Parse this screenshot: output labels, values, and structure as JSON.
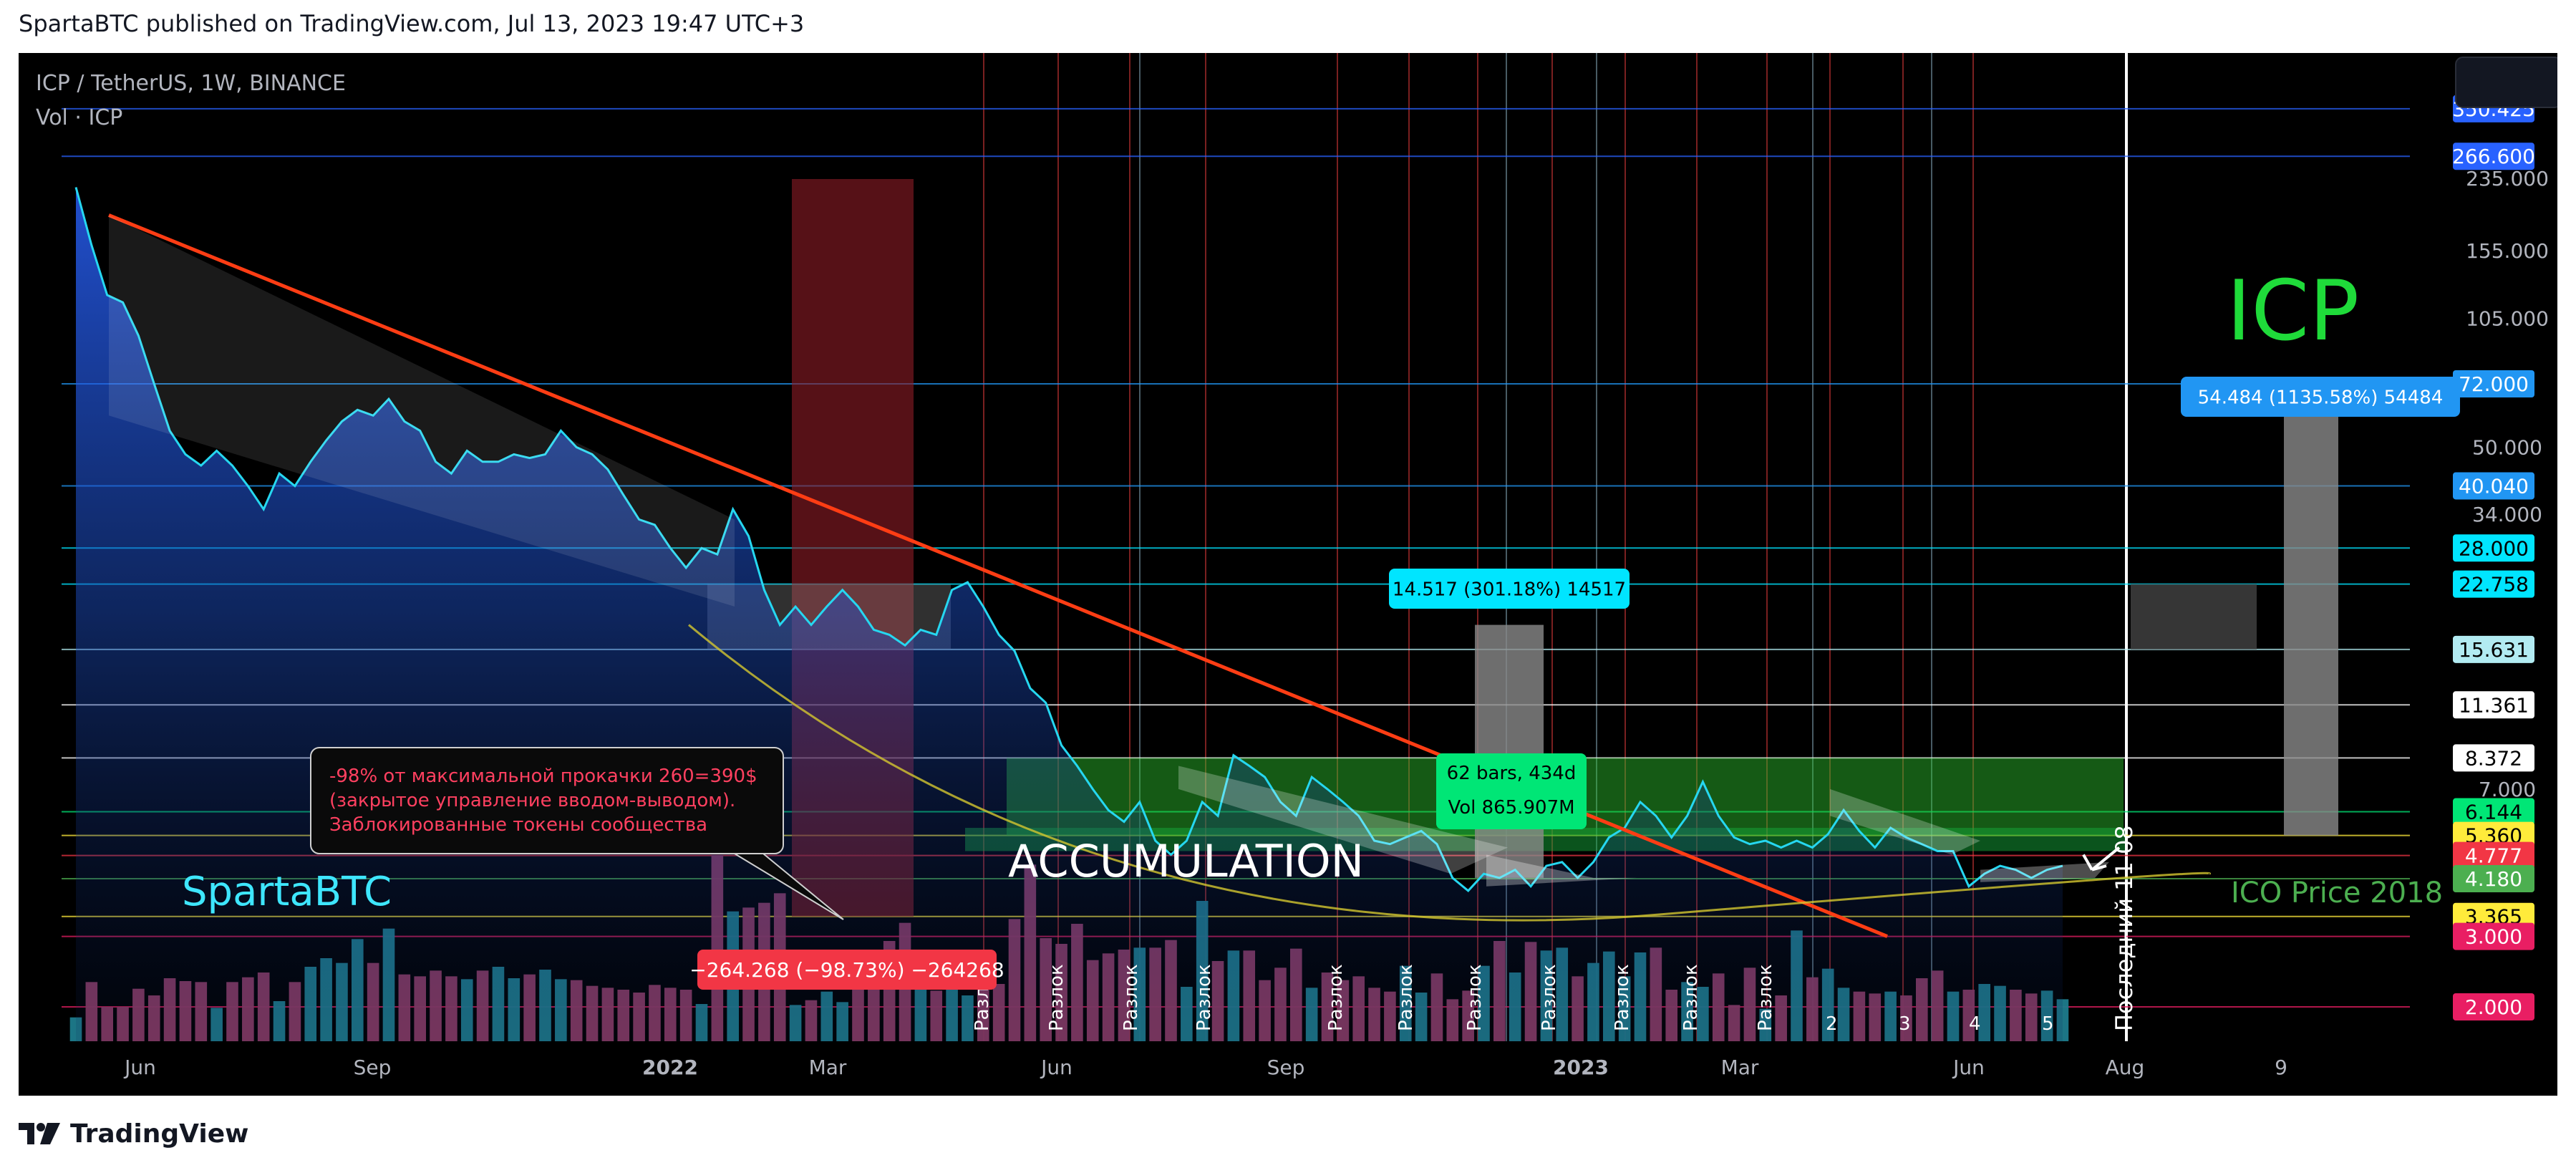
{
  "header": {
    "publisher": "SpartaBTC published on TradingView.com, Jul 13, 2023 19:47 UTC+3"
  },
  "legend": {
    "symbol": "ICP / TetherUS, 1W, BINANCE",
    "volume": "Vol · ICP"
  },
  "footer": {
    "brand": "TradingView"
  },
  "watermark": "SpartaBTC",
  "title_big": "ICP",
  "colors": {
    "price_line": "#26d7f0",
    "area_top": "#2962ff",
    "trendline": "#ff3d14",
    "vol_up": "#1e7b8c",
    "vol_down": "#8b3a62",
    "accum_zone": "#2ec72e",
    "axis_text": "#b2b5be"
  },
  "chart_data": {
    "type": "line",
    "scale": "log",
    "ylim": [
      2,
      520
    ],
    "x_ticks": [
      "Jun",
      "Sep",
      "2022",
      "Mar",
      "Jun",
      "Sep",
      "2023",
      "Mar",
      "Jun",
      "Aug",
      "9"
    ],
    "y_ticks": [
      "235.000",
      "155.000",
      "105.000",
      "50.000",
      "34.000",
      "7.000"
    ],
    "price_badges": [
      {
        "label": "350.425",
        "color": "#2962ff",
        "text_color": "#ffffff"
      },
      {
        "label": "266.600",
        "color": "#2962ff",
        "text_color": "#ffffff"
      },
      {
        "label": "72.000",
        "color": "#2196f3",
        "text_color": "#ffffff"
      },
      {
        "label": "40.040",
        "color": "#2196f3",
        "text_color": "#ffffff"
      },
      {
        "label": "28.000",
        "color": "#00e5ff",
        "text_color": "#000000"
      },
      {
        "label": "22.758",
        "color": "#00e5ff",
        "text_color": "#000000"
      },
      {
        "label": "15.631",
        "color": "#b2ebf2",
        "text_color": "#000000"
      },
      {
        "label": "11.361",
        "color": "#ffffff",
        "text_color": "#000000"
      },
      {
        "label": "8.372",
        "color": "#ffffff",
        "text_color": "#000000"
      },
      {
        "label": "6.144",
        "color": "#00e676",
        "text_color": "#000000"
      },
      {
        "label": "5.360",
        "color": "#ffeb3b",
        "text_color": "#000000"
      },
      {
        "label": "4.777",
        "color": "#f23645",
        "text_color": "#ffffff"
      },
      {
        "label": "4.180",
        "color": "#4caf50",
        "text_color": "#ffffff"
      },
      {
        "label": "3.365",
        "color": "#ffeb3b",
        "text_color": "#000000"
      },
      {
        "label": "3.000",
        "color": "#e91e63",
        "text_color": "#ffffff"
      },
      {
        "label": "2.000",
        "color": "#e91e63",
        "text_color": "#ffffff"
      }
    ],
    "price": [
      223.0,
      160.0,
      120.0,
      115.0,
      95.0,
      72.0,
      55.0,
      48.0,
      45.0,
      49.0,
      45.0,
      40.0,
      35.0,
      43.0,
      40.0,
      46.0,
      52.0,
      58.0,
      62.0,
      60.0,
      66.0,
      58.0,
      55.0,
      46.0,
      43.0,
      49.0,
      46.0,
      46.0,
      48.0,
      47.0,
      48.0,
      55.0,
      50.0,
      48.0,
      44.0,
      38.0,
      33.0,
      32.0,
      28.0,
      25.0,
      28.0,
      27.0,
      35.0,
      30.0,
      22.0,
      18.0,
      20.0,
      18.0,
      20.0,
      22.0,
      20.0,
      17.5,
      17.0,
      16.0,
      17.5,
      17.0,
      22.0,
      23.0,
      20.0,
      17.0,
      15.5,
      12.5,
      11.5,
      9.0,
      8.0,
      7.0,
      6.2,
      5.8,
      6.5,
      5.2,
      4.8,
      5.2,
      6.5,
      6.0,
      8.5,
      8.0,
      7.5,
      6.5,
      6.0,
      7.5,
      7.0,
      6.5,
      6.0,
      5.2,
      5.1,
      5.3,
      5.5,
      5.1,
      4.2,
      3.9,
      4.3,
      4.2,
      4.4,
      4.0,
      4.5,
      4.6,
      4.2,
      4.6,
      5.3,
      5.6,
      6.5,
      6.0,
      5.3,
      6.0,
      7.3,
      6.0,
      5.3,
      5.1,
      5.2,
      5.0,
      5.2,
      5.0,
      5.4,
      6.2,
      5.5,
      5.0,
      5.6,
      5.3,
      5.1,
      4.9,
      4.9,
      4.0,
      4.3,
      4.5,
      4.4,
      4.2,
      4.4,
      4.5
    ],
    "volume": [
      25,
      62,
      36,
      36,
      55,
      48,
      66,
      63,
      62,
      35,
      62,
      67,
      72,
      42,
      62,
      78,
      87,
      82,
      107,
      82,
      118,
      70,
      68,
      74,
      68,
      65,
      74,
      78,
      66,
      70,
      75,
      65,
      64,
      58,
      56,
      54,
      51,
      59,
      56,
      54,
      39,
      195,
      136,
      140,
      145,
      155,
      38,
      43,
      52,
      41,
      59,
      66,
      105,
      124,
      88,
      53,
      60,
      48,
      85,
      60,
      128,
      185,
      108,
      102,
      123,
      85,
      92,
      96,
      98,
      98,
      106,
      57,
      147,
      84,
      95,
      95,
      64,
      77,
      97,
      56,
      72,
      64,
      68,
      56,
      52,
      79,
      51,
      71,
      44,
      53,
      79,
      105,
      72,
      104,
      95,
      98,
      68,
      82,
      94,
      68,
      93,
      98,
      54,
      62,
      57,
      71,
      38,
      77,
      34,
      48,
      116,
      67,
      76,
      56,
      52,
      50,
      52,
      48,
      66,
      74,
      52,
      54,
      60,
      58,
      54,
      50,
      53,
      44
    ],
    "annotations": {
      "accumulation": "ACCUMULATION",
      "ico_price": "ICO Price 2018",
      "last_label": "Последний 11 08",
      "note": [
        "-98% от максимальной прокачки 260=390$",
        "(закрытое управление вводом-выводом).",
        "Заблокированные токены сообщества"
      ],
      "drawdown": "−264.268 (−98.73%) −264268",
      "bars_info": "62 bars, 434d",
      "vol_info": "Vol 865.907M",
      "gain_small": "14.517 (301.18%) 14517",
      "gain_big": "54.484 (1135.58%) 54484",
      "breakout": "Разлок",
      "breakout_markers": [
        "2",
        "3",
        "4",
        "5"
      ]
    }
  }
}
